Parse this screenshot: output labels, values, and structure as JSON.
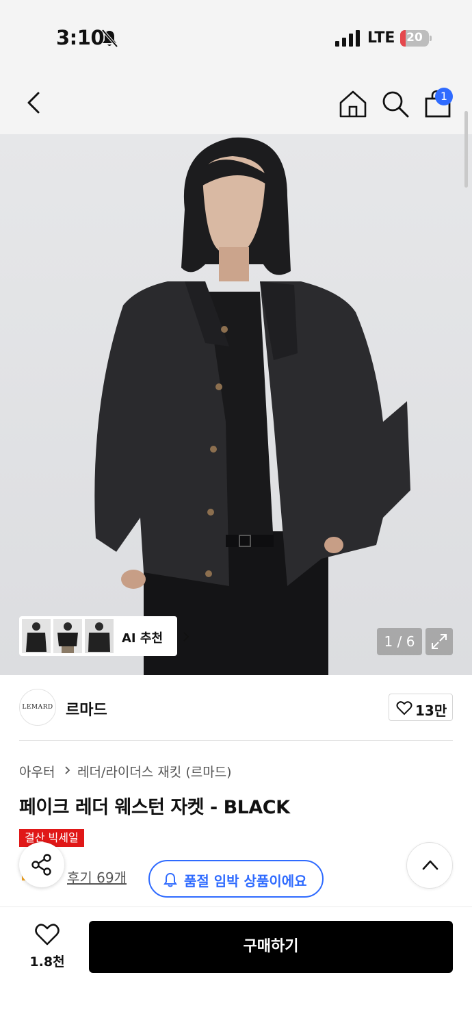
{
  "status_bar": {
    "time": "3:10",
    "network": "LTE",
    "battery": "20",
    "battery_level_percent": 20,
    "icons": [
      "bell-slash-icon",
      "signal-icon",
      "battery-icon"
    ]
  },
  "nav": {
    "icons": [
      "chevron-left-icon",
      "home-icon",
      "search-icon",
      "shopping-bag-icon"
    ],
    "cart_badge": "1"
  },
  "gallery": {
    "ai_label": "AI 추천",
    "counter": "1 / 6",
    "icons": [
      "chevron-right-icon",
      "expand-icon"
    ]
  },
  "brand": {
    "logo_text": "LEMARD",
    "name": "르마드",
    "like_count": "13만"
  },
  "breadcrumb": {
    "category": "아우터",
    "subcategory": "레더/라이더스 재킷 (르마드)"
  },
  "product": {
    "title": "페이크 레더 웨스턴 자켓 - BLACK",
    "sale_badge": "결산 빅세일",
    "review": "후기 69개",
    "soldout_notice": "품절 임박 상품이에요"
  },
  "bottom_bar": {
    "wish_count": "1.8천",
    "buy_label": "구매하기"
  },
  "colors": {
    "accent_blue": "#2f6bff",
    "sale_red": "#e01717",
    "buy_button": "#000000"
  }
}
